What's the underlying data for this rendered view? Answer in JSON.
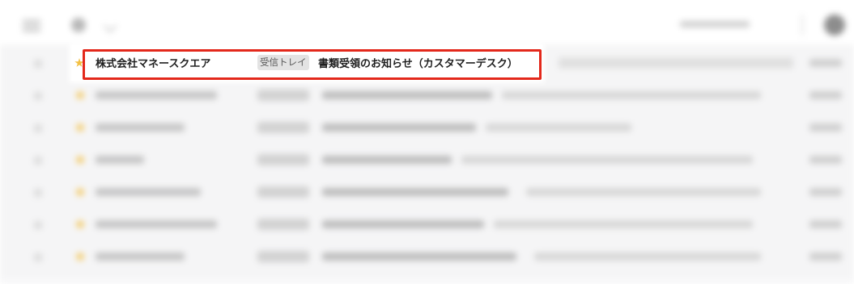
{
  "highlighted_email": {
    "sender": "株式会社マネースクエア",
    "folder_badge": "受信トレイ",
    "subject": "書類受領のお知らせ（カスタマーデスク）"
  },
  "colors": {
    "highlight_border": "#e3281b",
    "star": "#f3c043",
    "badge_background": "#e3e3e3"
  },
  "icons": {
    "menu": "hamburger-menu-icon",
    "settings": "gear-icon",
    "star": "star-icon",
    "avatar": "account-avatar-icon"
  }
}
